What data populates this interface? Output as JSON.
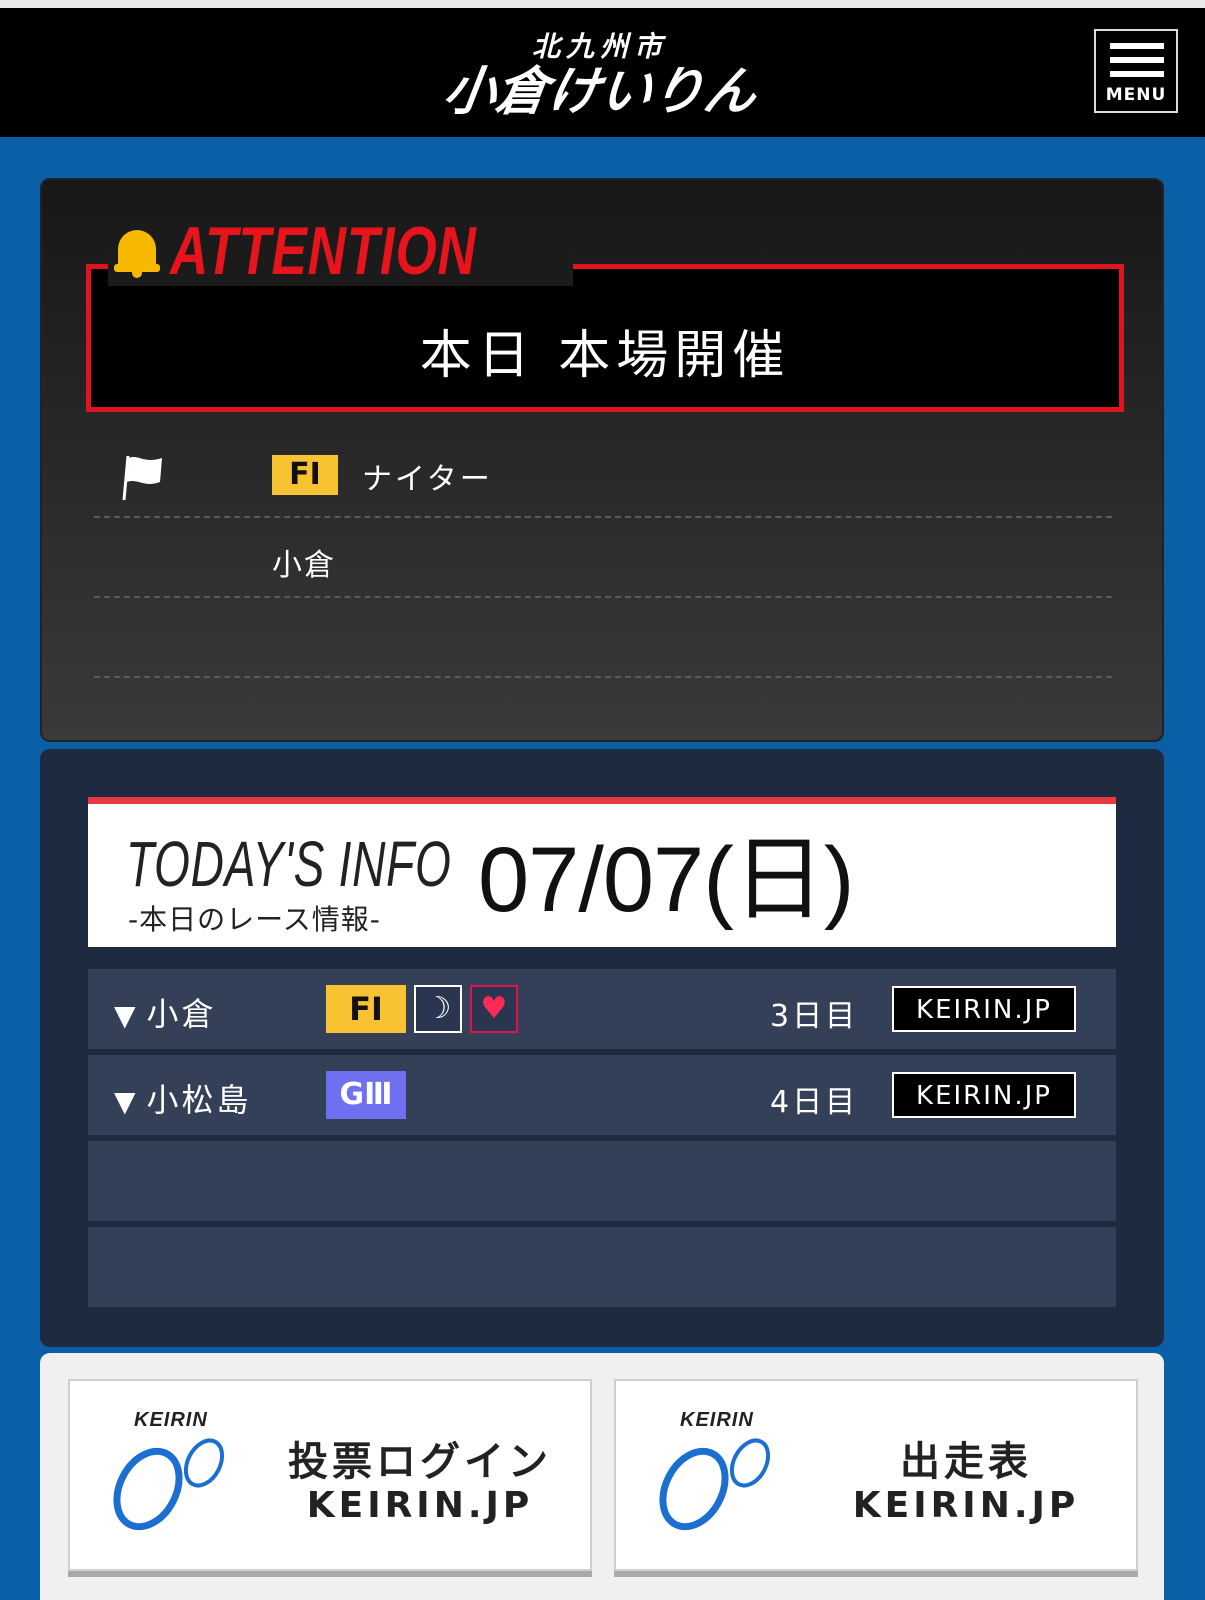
{
  "header": {
    "logo_sub": "北九州市",
    "logo_main": "小倉けいりん",
    "menu_label": "MENU"
  },
  "attention": {
    "title": "ATTENTION",
    "message": "本日 本場開催",
    "grade": "FI",
    "grade_text": "ナイター",
    "venue": "小倉"
  },
  "todays_info": {
    "label_en": "TODAY'S INFO",
    "label_jp": "-本日のレース情報-",
    "date": "07/07(日)",
    "races": [
      {
        "venue": "小倉",
        "grade": "FI",
        "icons": [
          "moon-icon",
          "heart-icon"
        ],
        "day": "3日目",
        "link": "KEIRIN.JP"
      },
      {
        "venue": "小松島",
        "grade": "GⅢ",
        "icons": [],
        "day": "4日目",
        "link": "KEIRIN.JP"
      }
    ]
  },
  "bottom_buttons": [
    {
      "logo_text": "KEIRIN",
      "line1": "投票ログイン",
      "line2": "KEIRIN.JP"
    },
    {
      "logo_text": "KEIRIN",
      "line1": "出走表",
      "line2": "KEIRIN.JP"
    }
  ],
  "colors": {
    "page_bg": "#0a5fa6",
    "attention_red": "#e0141e",
    "fi_yellow": "#f8c233",
    "g3_purple": "#6e70f0",
    "keirin_blue": "#1a6fd0"
  }
}
